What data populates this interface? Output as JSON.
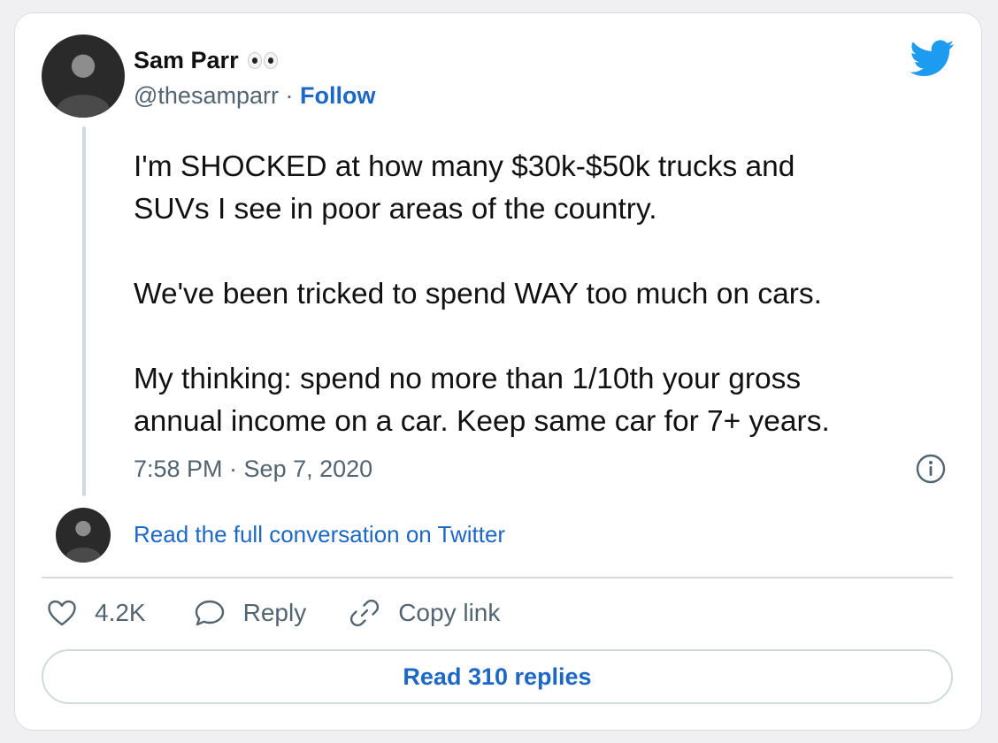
{
  "author": {
    "name": "Sam Parr",
    "name_emoji_icon": "eyes-icon",
    "handle": "@thesamparr",
    "separator": "·",
    "follow_label": "Follow",
    "avatar_icon": "avatar-icon"
  },
  "brand": {
    "logo_icon": "twitter-bird-icon",
    "accent_color": "#1d9bf0",
    "link_color": "#1d68c7"
  },
  "tweet": {
    "paragraphs": [
      "I'm SHOCKED at how many $30k-$50k trucks and\nSUVs I see in poor areas of the country.",
      "We've been tricked to spend WAY too much on cars.",
      "My thinking: spend no more than 1/10th your gross\nannual income on a car. Keep same car for 7+ years."
    ],
    "timestamp": "7:58 PM · Sep 7, 2020",
    "info_icon": "info-icon"
  },
  "conversation": {
    "link_label": "Read the full conversation on Twitter"
  },
  "actions": {
    "like_icon": "heart-icon",
    "like_count": "4.2K",
    "reply_icon": "reply-bubble-icon",
    "reply_label": "Reply",
    "copy_icon": "link-icon",
    "copy_label": "Copy link"
  },
  "footer": {
    "read_replies_label": "Read 310 replies"
  }
}
